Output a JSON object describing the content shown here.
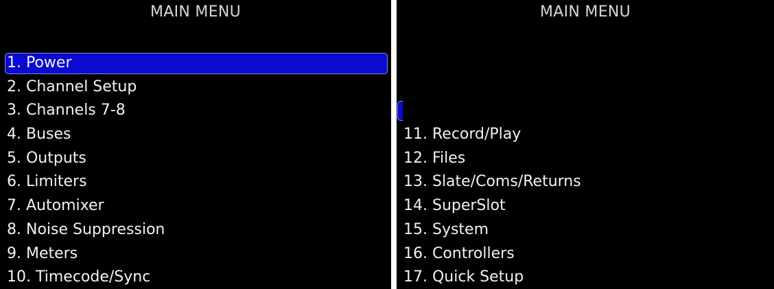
{
  "colors": {
    "background": "#000000",
    "text": "#f2f2f2",
    "title": "#d8d8d8",
    "selection": "#0a0ad0"
  },
  "left_screen": {
    "title": "MAIN MENU",
    "items": [
      {
        "label": "1. Power",
        "selected": true
      },
      {
        "label": "2. Channel Setup",
        "selected": false
      },
      {
        "label": "3. Channels 7-8",
        "selected": false
      },
      {
        "label": "4. Buses",
        "selected": false
      },
      {
        "label": "5. Outputs",
        "selected": false
      },
      {
        "label": "6. Limiters",
        "selected": false
      },
      {
        "label": "7. Automixer",
        "selected": false
      },
      {
        "label": "8. Noise Suppression",
        "selected": false
      },
      {
        "label": "9. Meters",
        "selected": false
      },
      {
        "label": "10. Timecode/Sync",
        "selected": false
      }
    ]
  },
  "right_screen": {
    "title": "MAIN MENU",
    "items": [
      {
        "label": "11. Record/Play",
        "selected": false
      },
      {
        "label": "12. Files",
        "selected": false
      },
      {
        "label": "13. Slate/Coms/Returns",
        "selected": false
      },
      {
        "label": "14. SuperSlot",
        "selected": false
      },
      {
        "label": "15. System",
        "selected": false
      },
      {
        "label": "16. Controllers",
        "selected": false
      },
      {
        "label": "17. Quick Setup",
        "selected": false
      }
    ]
  }
}
